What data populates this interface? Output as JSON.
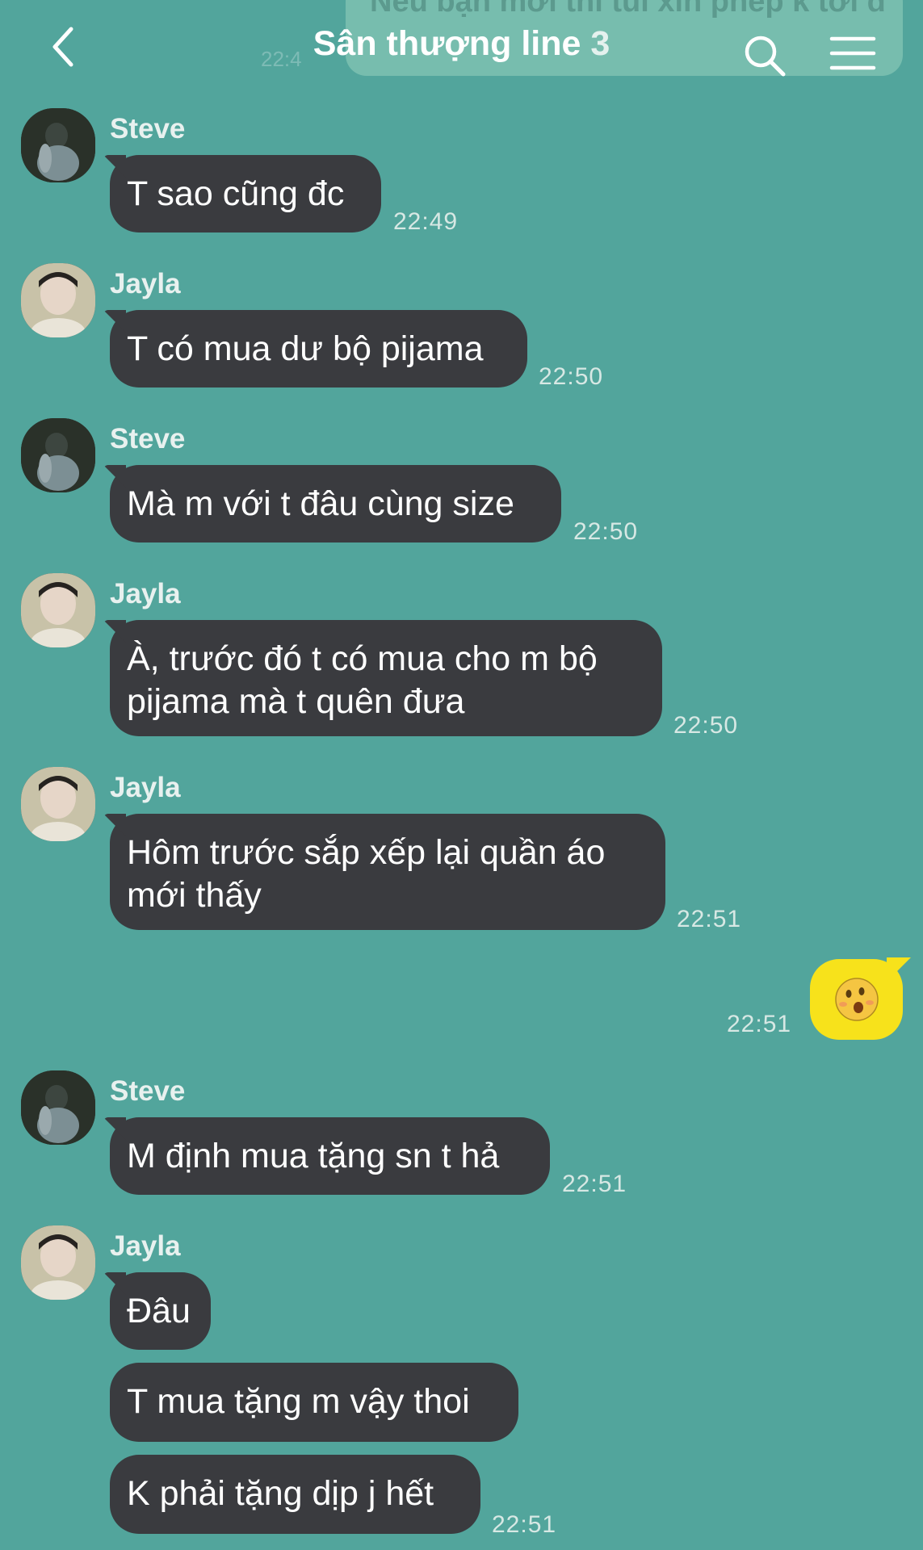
{
  "header": {
    "title": "Sân thượng line",
    "member_count": "3",
    "pinned_preview": "Nếu bạn mới thì tui xin phép k tới đi",
    "pinned_time": "22:4"
  },
  "messages": [
    {
      "sender": "Steve",
      "text": "T sao cũng đc",
      "time": "22:49"
    },
    {
      "sender": "Jayla",
      "text": "T có mua dư bộ pijama",
      "time": "22:50"
    },
    {
      "sender": "Steve",
      "text": "Mà m với t đâu cùng size",
      "time": "22:50"
    },
    {
      "sender": "Jayla",
      "line1": "À, trước đó t có mua cho m bộ",
      "line2": "pijama mà t quên đưa",
      "time": "22:50"
    },
    {
      "sender": "Jayla",
      "line1": "Hôm trước sắp xếp lại quần áo",
      "line2": "mới thấy",
      "time": "22:51"
    },
    {
      "sender": "me",
      "sticker": "😯",
      "time": "22:51"
    },
    {
      "sender": "Steve",
      "text": "M định mua tặng sn t hả",
      "time": "22:51"
    },
    {
      "sender": "Jayla",
      "text": "Đâu"
    },
    {
      "text": "T mua tặng m vậy thoi"
    },
    {
      "text": "K phải tặng dịp j hết",
      "time": "22:51"
    }
  ],
  "colors": {
    "background": "#52a59c",
    "bubble": "#3a3b3f",
    "own_sticker_bubble": "#f7e21b"
  },
  "icons": [
    "back-chevron-icon",
    "search-icon",
    "menu-icon"
  ]
}
